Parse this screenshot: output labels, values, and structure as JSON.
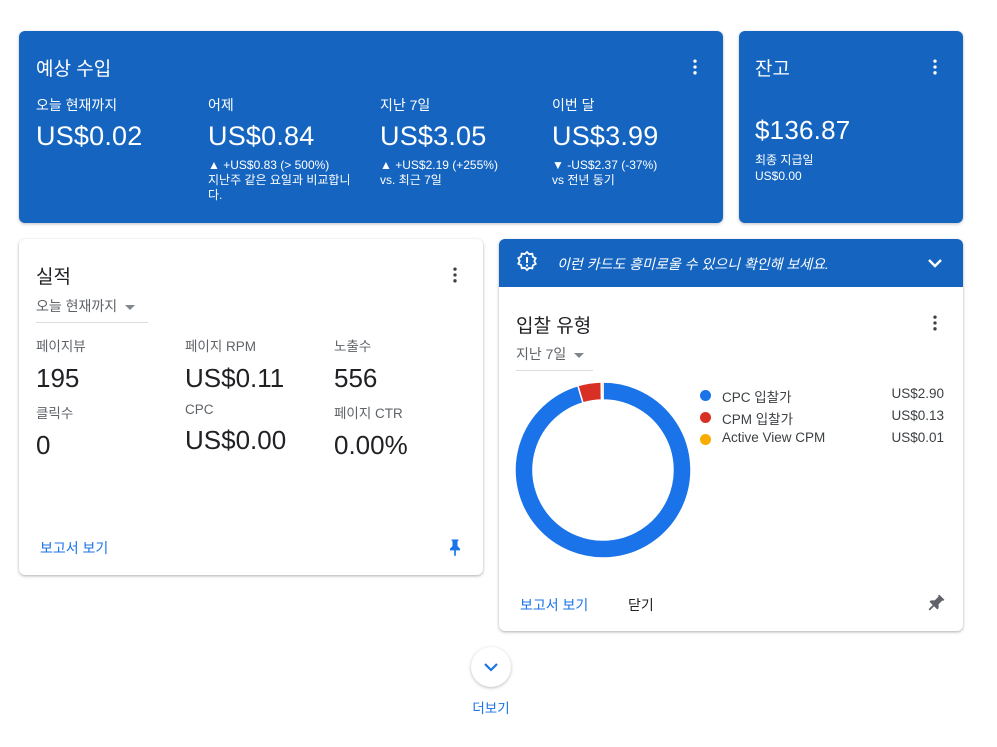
{
  "earnings": {
    "title": "예상 수입",
    "items": [
      {
        "label": "오늘 현재까지",
        "value": "US$0.02",
        "delta": "",
        "note": ""
      },
      {
        "label": "어제",
        "value": "US$0.84",
        "delta": "▲ +US$0.83 (> 500%)",
        "note": "지난주 같은 요일과 비교합니다."
      },
      {
        "label": "지난 7일",
        "value": "US$3.05",
        "delta": "▲ +US$2.19 (+255%)",
        "note": "vs. 최근 7일"
      },
      {
        "label": "이번 달",
        "value": "US$3.99",
        "delta": "▼ -US$2.37 (-37%)",
        "note": "vs 전년 동기"
      }
    ]
  },
  "balance": {
    "title": "잔고",
    "value": "$136.87",
    "last_payment_label": "최종 지급일",
    "last_payment_value": "US$0.00"
  },
  "performance": {
    "title": "실적",
    "period": "오늘 현재까지",
    "metrics": [
      {
        "label": "페이지뷰",
        "value": "195"
      },
      {
        "label": "페이지 RPM",
        "value": "US$0.11"
      },
      {
        "label": "노출수",
        "value": "556"
      },
      {
        "label": "클릭수",
        "value": "0"
      },
      {
        "label": "CPC",
        "value": "US$0.00"
      },
      {
        "label": "페이지 CTR",
        "value": "0.00%"
      }
    ],
    "report_link": "보고서 보기"
  },
  "bid_types": {
    "banner_text": "이런 카드도 흥미로울 수 있으니 확인해 보세요.",
    "title": "입찰 유형",
    "period": "지난 7일",
    "report_link": "보고서 보기",
    "close_label": "닫기"
  },
  "chart_data": {
    "type": "pie",
    "series": [
      {
        "name": "CPC 입찰가",
        "value": 2.9,
        "label": "US$2.90",
        "color": "#1a73e8"
      },
      {
        "name": "CPM 입찰가",
        "value": 0.13,
        "label": "US$0.13",
        "color": "#d93025"
      },
      {
        "name": "Active View CPM",
        "value": 0.01,
        "label": "US$0.01",
        "color": "#f9ab00"
      }
    ],
    "legend": "right",
    "donut": true
  },
  "more": {
    "label": "더보기"
  },
  "colors": {
    "primary_card": "#1565c0",
    "accent": "#1a73e8"
  }
}
